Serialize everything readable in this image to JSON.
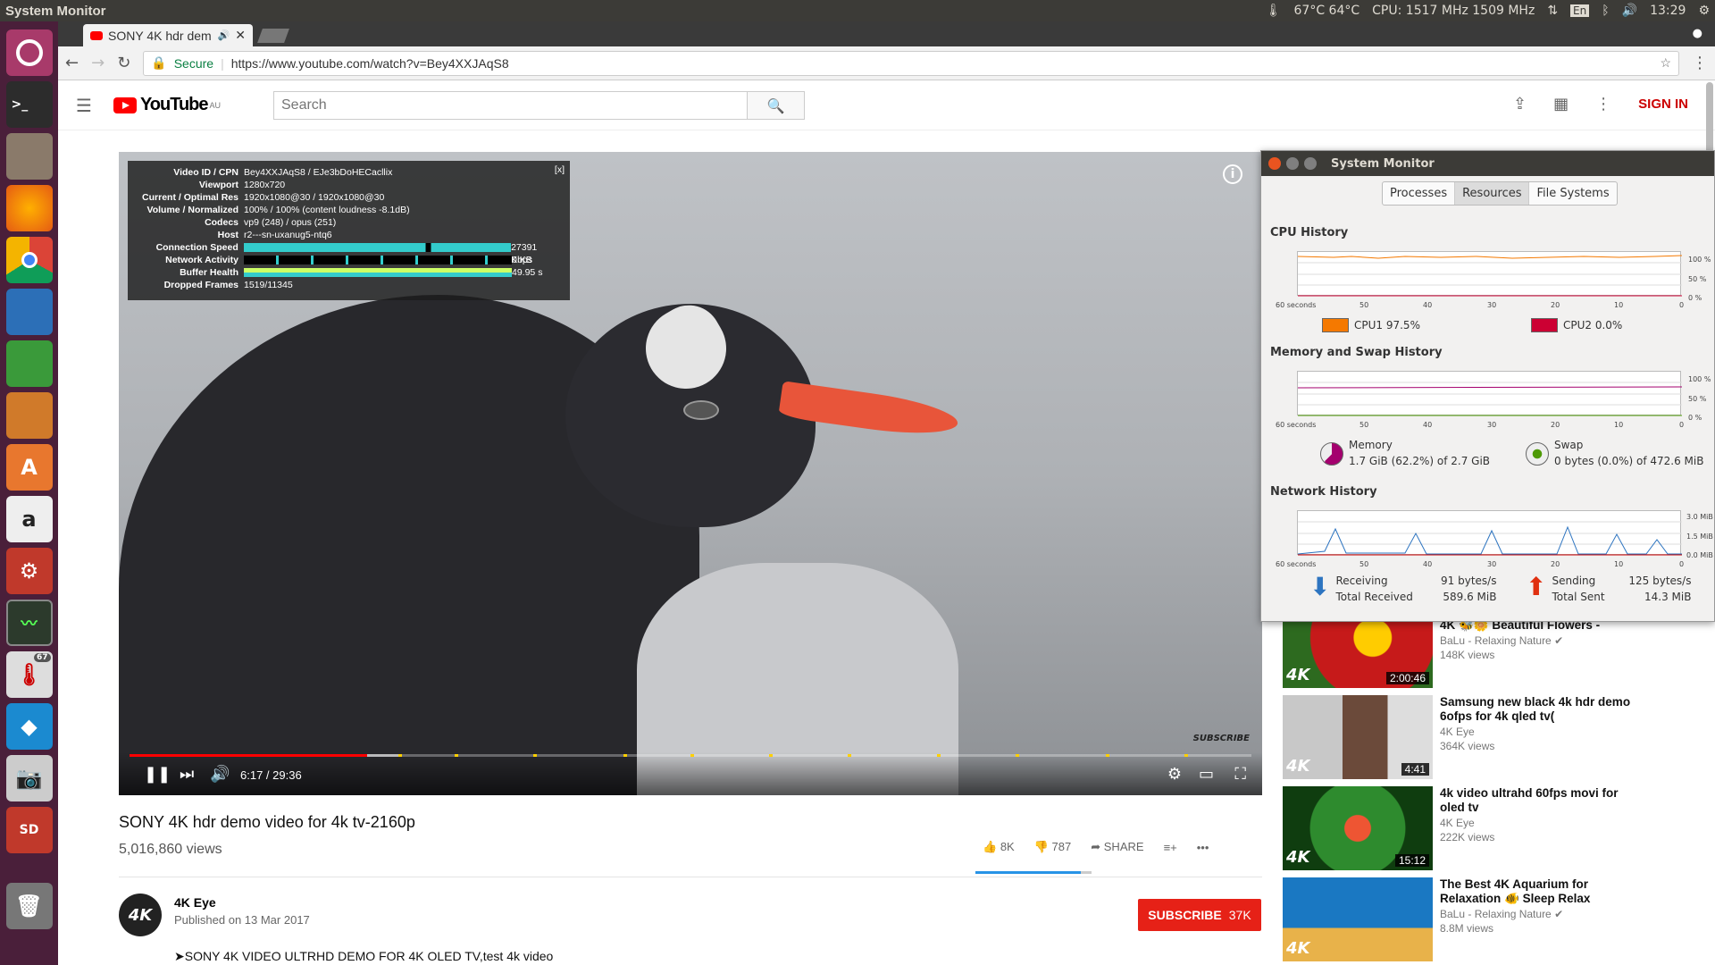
{
  "topbar": {
    "title": "System Monitor",
    "temps": "67°C 64°C",
    "cpu": "CPU: 1517 MHz 1509 MHz",
    "lang": "En",
    "time": "13:29"
  },
  "launcher": {
    "items": [
      "ubuntu-logo-icon",
      "terminal-icon",
      "files-icon",
      "firefox-icon",
      "chrome-icon",
      "writer-icon",
      "calc-icon",
      "impress-icon",
      "software-center-icon",
      "amazon-icon",
      "settings-icon",
      "system-monitor-icon",
      "thermometer-icon",
      "kodi-icon",
      "camera-icon",
      "sd-card-icon",
      "trash-icon"
    ],
    "badge": "67"
  },
  "browser": {
    "tab_title": "SONY 4K hdr dem",
    "secure": "Secure",
    "url": "https://www.youtube.com/watch?v=Bey4XXJAqS8"
  },
  "yt": {
    "logo": "YouTube",
    "region": "AU",
    "search_placeholder": "Search",
    "signin": "SIGN IN",
    "stats": {
      "labels": [
        "Video ID / CPN",
        "Viewport",
        "Current / Optimal Res",
        "Volume / Normalized",
        "Codecs",
        "Host",
        "Connection Speed",
        "Network Activity",
        "Buffer Health",
        "Dropped Frames"
      ],
      "values": [
        "Bey4XXJAqS8 / EJe3bDoHECacllix",
        "1280x720",
        "1920x1080@30 / 1920x1080@30",
        "100% / 100% (content loudness -8.1dB)",
        "vp9 (248) / opus (251)",
        "r2---sn-uxanug5-ntq6",
        "27391 Kbps",
        "0 KB",
        "49.95 s",
        "1519/11345"
      ],
      "close": "[x]"
    },
    "watermark": "SUBSCRIBE",
    "time": "6:17 / 29:36",
    "played_fraction": 0.212,
    "loaded_fraction": 0.243,
    "title": "SONY 4K hdr demo video for 4k tv-2160p",
    "views": "5,016,860 views",
    "likes": "8K",
    "dislikes": "787",
    "share": "SHARE",
    "like_ratio": 0.91,
    "channel": "4K Eye",
    "published": "Published on 13 Mar 2017",
    "subscribe": "SUBSCRIBE",
    "subs": "37K",
    "avatar": "4K",
    "description": "➤SONY 4K VIDEO ULTRHD DEMO FOR 4K OLED TV,test 4k video",
    "recs": [
      {
        "title": "Breathtaking Colors of Nature in 4K 🐝🌼 Beautiful Flowers -",
        "channel": "BaLu - Relaxing Nature ✔",
        "views": "148K views",
        "duration": "2:00:46",
        "badge": "4K"
      },
      {
        "title": "Samsung new black 4k hdr demo 6ofps for 4k qled tv(",
        "channel": "4K Eye",
        "views": "364K views",
        "duration": "4:41",
        "badge": "4K"
      },
      {
        "title": "4k video ultrahd 60fps movi for oled tv",
        "channel": "4K Eye",
        "views": "222K views",
        "duration": "15:12",
        "badge": "4K"
      },
      {
        "title": "The Best 4K Aquarium for Relaxation 🐠 Sleep Relax",
        "channel": "BaLu - Relaxing Nature ✔",
        "views": "8.8M views",
        "duration": "",
        "badge": "4K"
      }
    ]
  },
  "sysmon": {
    "title": "System Monitor",
    "tabs": [
      "Processes",
      "Resources",
      "File Systems"
    ],
    "cpu_title": "CPU History",
    "mem_title": "Memory and Swap History",
    "net_title": "Network History",
    "x_labels": [
      "60 seconds",
      "50",
      "40",
      "30",
      "20",
      "10",
      "0"
    ],
    "cpu_y": [
      "100 %",
      "50 %",
      "0 %"
    ],
    "mem_y": [
      "100 %",
      "50 %",
      "0 %"
    ],
    "net_y": [
      "3.0 MiB",
      "1.5 MiB",
      "0.0 MiB"
    ],
    "cpu1": "CPU1  97.5%",
    "cpu2": "CPU2  0.0%",
    "cpu1_color": "#f57900",
    "cpu2_color": "#cc0033",
    "memory_label": "Memory",
    "memory_value": "1.7 GiB (62.2%) of 2.7 GiB",
    "swap_label": "Swap",
    "swap_value": "0 bytes (0.0%) of 472.6 MiB",
    "receiving": "Receiving",
    "recv_rate": "91 bytes/s",
    "total_received": "Total Received",
    "recv_total": "589.6 MiB",
    "sending": "Sending",
    "send_rate": "125 bytes/s",
    "total_sent": "Total Sent",
    "send_total": "14.3 MiB"
  }
}
